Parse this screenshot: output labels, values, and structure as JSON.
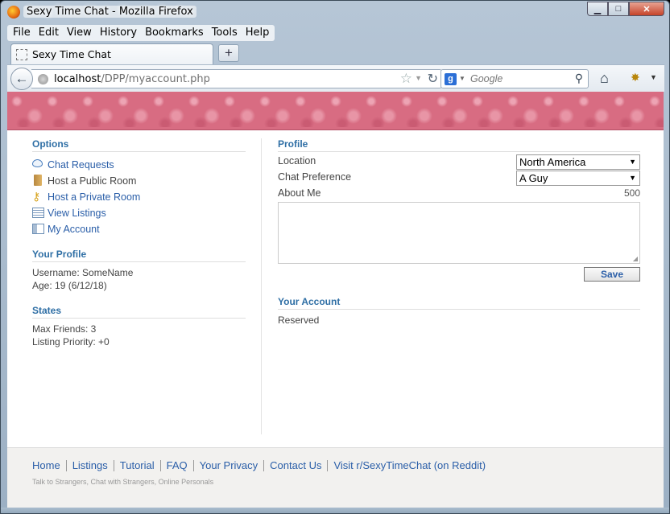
{
  "window": {
    "title": "Sexy Time Chat - Mozilla Firefox",
    "controls": {
      "minimize": "▁",
      "maximize": "□",
      "close": "✕"
    }
  },
  "menu": [
    "File",
    "Edit",
    "View",
    "History",
    "Bookmarks",
    "Tools",
    "Help"
  ],
  "tabs": [
    {
      "label": "Sexy Time Chat"
    }
  ],
  "newtab_label": "+",
  "nav": {
    "url_host": "localhost",
    "url_path": "/DPP/myaccount.php",
    "search_engine_letter": "g",
    "search_placeholder": "Google"
  },
  "sidebar": {
    "options_title": "Options",
    "options": [
      {
        "label": "Chat Requests",
        "icon": "chat-bubble-icon",
        "link": true
      },
      {
        "label": "Host a Public Room",
        "icon": "door-icon",
        "link": false
      },
      {
        "label": "Host a Private Room",
        "icon": "key-icon",
        "link": true
      },
      {
        "label": "View Listings",
        "icon": "list-icon",
        "link": true
      },
      {
        "label": "My Account",
        "icon": "id-card-icon",
        "link": true
      }
    ],
    "profile_title": "Your Profile",
    "username": "Username: SomeName",
    "age": "Age: 19 (6/12/18)",
    "states_title": "States",
    "max_friends": "Max Friends: 3",
    "listing_priority": "Listing Priority: +0"
  },
  "profile": {
    "title": "Profile",
    "location_label": "Location",
    "location_value": "North America",
    "preference_label": "Chat Preference",
    "preference_value": "A Guy",
    "about_label": "About Me",
    "about_counter": "500",
    "about_value": "",
    "save_label": "Save"
  },
  "account": {
    "title": "Your Account",
    "text": "Reserved"
  },
  "footer": {
    "links": [
      "Home",
      "Listings",
      "Tutorial",
      "FAQ",
      "Your Privacy",
      "Contact Us",
      "Visit r/SexyTimeChat (on Reddit)"
    ],
    "tagline": "Talk to Strangers, Chat with Strangers, Online Personals"
  },
  "colors": {
    "accent": "#2f6fa5",
    "link": "#2a5ea8",
    "banner": "#d86c82"
  }
}
